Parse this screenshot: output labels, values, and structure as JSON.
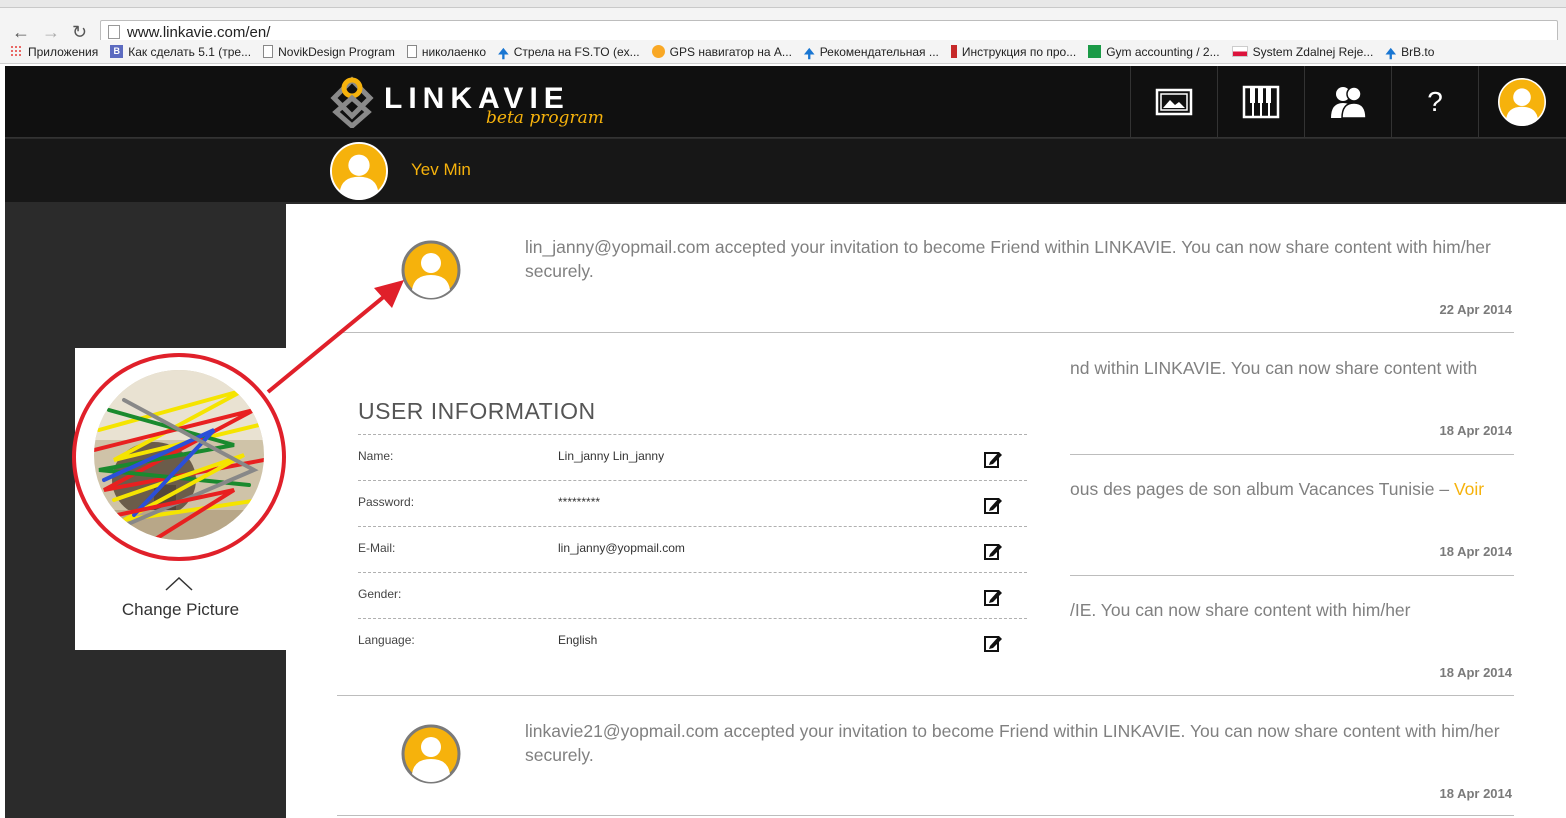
{
  "browser": {
    "url": "www.linkavie.com/en/",
    "bookmarks": [
      {
        "label": "Приложения",
        "icon": "apps-grid-icon"
      },
      {
        "label": "Как сделать 5.1 (тре...",
        "icon": "page-b-icon"
      },
      {
        "label": "NovikDesign Program",
        "icon": "page-icon"
      },
      {
        "label": "николаенко",
        "icon": "page-icon"
      },
      {
        "label": "Стрела на FS.TO (ex...",
        "icon": "arrow-up-icon"
      },
      {
        "label": "GPS навигатор на А...",
        "icon": "gps-icon"
      },
      {
        "label": "Рекомендательная ...",
        "icon": "arrow-up-icon"
      },
      {
        "label": "Инструкция по про...",
        "icon": "bookmark-red-icon"
      },
      {
        "label": "Gym accounting / 2...",
        "icon": "sheets-icon"
      },
      {
        "label": "System Zdalnej Reje...",
        "icon": "poland-flag-icon"
      },
      {
        "label": "BrB.to",
        "icon": "arrow-up-icon"
      }
    ]
  },
  "site": {
    "logo_text": "LINKAVIE",
    "logo_sub": "beta program",
    "nav_icons": [
      "photos-icon",
      "piano-icon",
      "friends-icon",
      "help-icon",
      "profile-icon"
    ],
    "help_glyph": "?",
    "username": "Yev Min",
    "accent": "#f6b20c"
  },
  "notifications": [
    {
      "text": "lin_janny@yopmail.com accepted your invitation to become Friend within LINKAVIE. You can now share content with him/her securely.",
      "date": "22 Apr 2014"
    },
    {
      "text": "nd within LINKAVIE. You can now share content with",
      "date": "18 Apr 2014"
    },
    {
      "text": "ous des pages de son album Vacances Tunisie – ",
      "link": "Voir",
      "date": "18 Apr 2014"
    },
    {
      "text": "/IE. You can now share content with him/her",
      "date": "18 Apr 2014"
    },
    {
      "text": "linkavie21@yopmail.com accepted your invitation to become Friend within LINKAVIE. You can now share content with him/her securely.",
      "date": "18 Apr 2014"
    }
  ],
  "user_info": {
    "title": "USER INFORMATION",
    "rows": [
      {
        "label": "Name:",
        "value": "Lin_janny Lin_janny"
      },
      {
        "label": "Password:",
        "value": "*********"
      },
      {
        "label": "E-Mail:",
        "value": "lin_janny@yopmail.com"
      },
      {
        "label": "Gender:",
        "value": ""
      },
      {
        "label": "Language:",
        "value": "English"
      }
    ]
  },
  "picture_panel": {
    "change_label": "Change Picture"
  }
}
